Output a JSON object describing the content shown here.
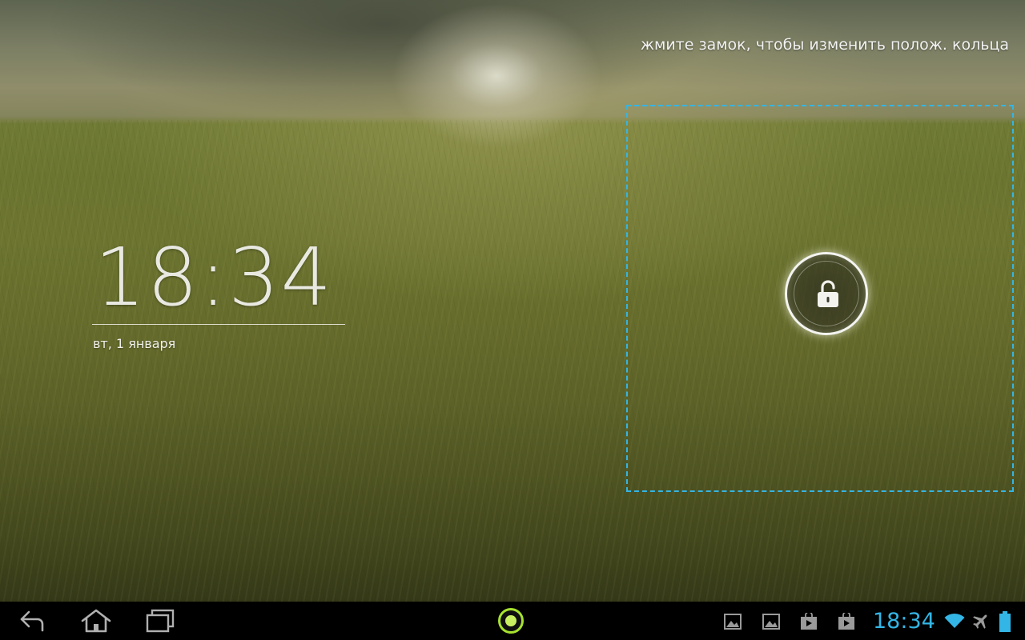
{
  "lockscreen": {
    "hint": "жмите замок, чтобы изменить полож. кольца",
    "clock": {
      "time": "18:34",
      "date": "вт, 1 января"
    },
    "unlock_icon": "unlock-icon"
  },
  "system_bar": {
    "nav": {
      "back_icon": "back-arrow-icon",
      "home_icon": "home-icon",
      "recent_icon": "recent-apps-icon"
    },
    "center_icon": "camera-dot-icon",
    "notifications": [
      "gallery-icon",
      "gallery-icon",
      "play-store-icon",
      "play-store-icon"
    ],
    "clock": "18:34",
    "status_icons": [
      "wifi-icon",
      "airplane-mode-icon",
      "battery-icon"
    ]
  },
  "colors": {
    "accent": "#33b5e5",
    "camera_ring": "#a6e22e",
    "bar_background": "#000000",
    "icon_gray": "#a0a0a0"
  }
}
